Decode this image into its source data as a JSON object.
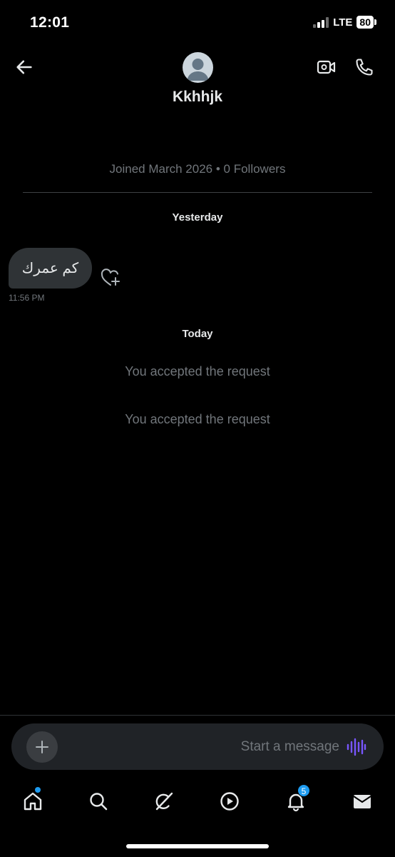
{
  "status_bar": {
    "time": "12:01",
    "network": "LTE",
    "battery": "80"
  },
  "header": {
    "username": "Kkhhjk"
  },
  "profile": {
    "joined_text": "Joined March 2026 • 0 Followers"
  },
  "conversation": {
    "yesterday_label": "Yesterday",
    "message": {
      "text": "كم عمرك",
      "time": "11:56 PM"
    },
    "today_label": "Today",
    "system_messages": [
      "You accepted the request",
      "You accepted the request"
    ]
  },
  "composer": {
    "placeholder": "Start a message"
  },
  "tabbar": {
    "notifications_count": "5"
  },
  "colors": {
    "accent": "#1d9bf0",
    "voice": "#7856ff",
    "bubble": "#2f3336",
    "muted": "#71767b"
  },
  "icons": [
    "back-arrow-icon",
    "avatar-placeholder",
    "video-camera-icon",
    "phone-icon",
    "heart-plus-icon",
    "plus-icon",
    "voice-wave-icon",
    "home-icon",
    "search-icon",
    "grok-icon",
    "play-icon",
    "bell-icon",
    "mail-icon"
  ]
}
